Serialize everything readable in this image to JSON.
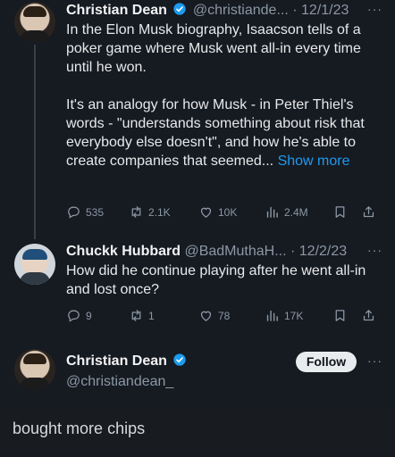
{
  "tweets": [
    {
      "name": "Christian Dean",
      "verified": true,
      "handle": "@christiande...",
      "date": "12/1/23",
      "more": "···",
      "text": "In the Elon Musk biography, Isaacson tells of a poker game where Musk went all-in every time until he won.\n\nIt's an analogy for how Musk - in Peter Thiel's words - \"understands something about risk that everybody else doesn't\", and how he's able to create companies that seemed...",
      "show_more": "Show more",
      "stats": {
        "replies": "535",
        "retweets": "2.1K",
        "likes": "10K",
        "views": "2.4M"
      }
    },
    {
      "name": "Chuckk Hubbard",
      "verified": false,
      "handle": "@BadMuthaH...",
      "date": "12/2/23",
      "more": "···",
      "text": "How did he continue playing after he went all-in and lost once?",
      "stats": {
        "replies": "9",
        "retweets": "1",
        "likes": "78",
        "views": "17K"
      }
    },
    {
      "name": "Christian Dean",
      "verified": true,
      "handle": "@christiandean_",
      "follow_label": "Follow",
      "more": "···"
    }
  ],
  "reply": {
    "text": "bought more chips"
  },
  "colors": {
    "accent": "#1d9bf0",
    "muted": "#8b98a5",
    "background": "#161a21"
  },
  "icons": [
    "reply-icon",
    "retweet-icon",
    "heart-icon",
    "views-icon",
    "bookmark-icon",
    "share-icon",
    "verified-icon"
  ]
}
